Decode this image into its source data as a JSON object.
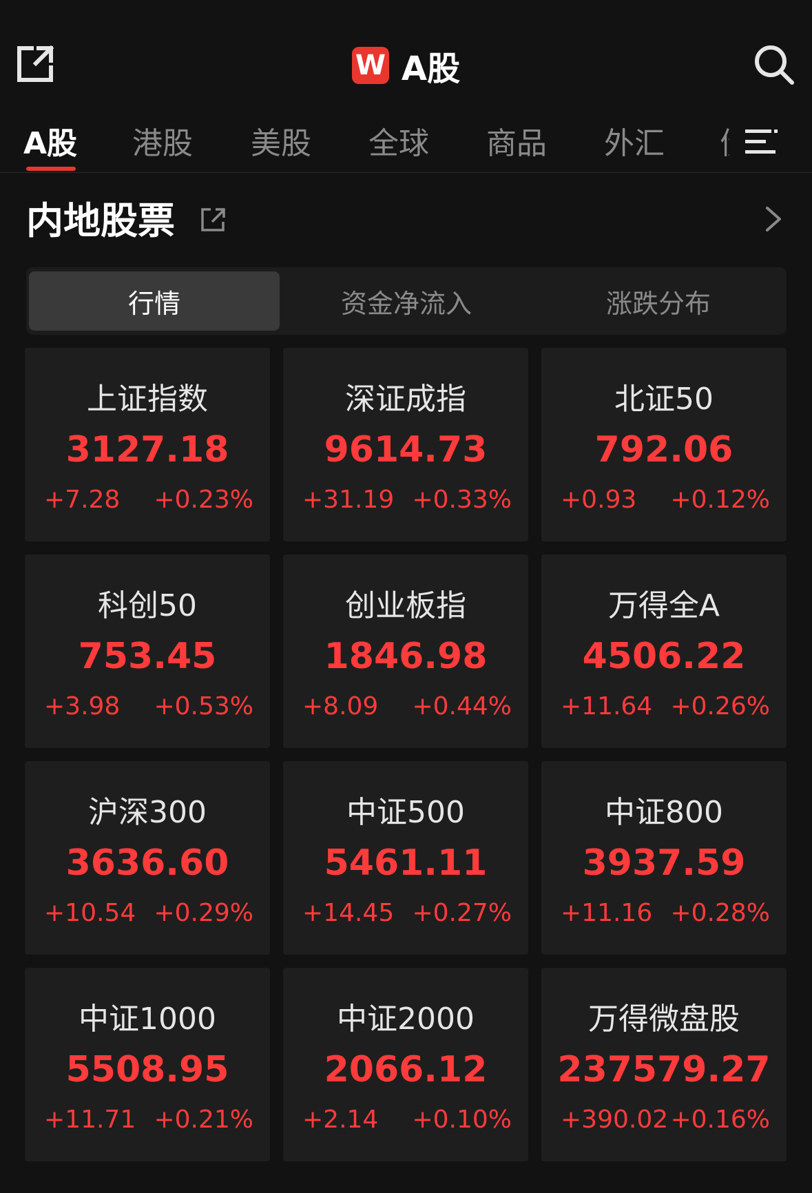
{
  "header": {
    "title": "A股",
    "logo_letter": "W",
    "icons": [
      "share-icon",
      "search-icon"
    ]
  },
  "tabs": [
    {
      "label": "A股",
      "active": true
    },
    {
      "label": "港股",
      "active": false
    },
    {
      "label": "美股",
      "active": false
    },
    {
      "label": "全球",
      "active": false
    },
    {
      "label": "商品",
      "active": false
    },
    {
      "label": "外汇",
      "active": false
    }
  ],
  "section": {
    "title": "内地股票"
  },
  "segments": [
    {
      "label": "行情",
      "active": true
    },
    {
      "label": "资金净流入",
      "active": false
    },
    {
      "label": "涨跌分布",
      "active": false
    }
  ],
  "indices": [
    {
      "name": "上证指数",
      "value": "3127.18",
      "change": "+7.28",
      "pct": "+0.23%"
    },
    {
      "name": "深证成指",
      "value": "9614.73",
      "change": "+31.19",
      "pct": "+0.33%"
    },
    {
      "name": "北证50",
      "value": "792.06",
      "change": "+0.93",
      "pct": "+0.12%"
    },
    {
      "name": "科创50",
      "value": "753.45",
      "change": "+3.98",
      "pct": "+0.53%"
    },
    {
      "name": "创业板指",
      "value": "1846.98",
      "change": "+8.09",
      "pct": "+0.44%"
    },
    {
      "name": "万得全A",
      "value": "4506.22",
      "change": "+11.64",
      "pct": "+0.26%"
    },
    {
      "name": "沪深300",
      "value": "3636.60",
      "change": "+10.54",
      "pct": "+0.29%"
    },
    {
      "name": "中证500",
      "value": "5461.11",
      "change": "+14.45",
      "pct": "+0.27%"
    },
    {
      "name": "中证800",
      "value": "3937.59",
      "change": "+11.16",
      "pct": "+0.28%"
    },
    {
      "name": "中证1000",
      "value": "5508.95",
      "change": "+11.71",
      "pct": "+0.21%"
    },
    {
      "name": "中证2000",
      "value": "2066.12",
      "change": "+2.14",
      "pct": "+0.10%"
    },
    {
      "name": "万得微盘股",
      "value": "237579.27",
      "change": "+390.02",
      "pct": "+0.16%"
    }
  ],
  "colors": {
    "background": "#121212",
    "card": "#1e1e1e",
    "up": "#ff3b3b",
    "accent": "#e8372f"
  }
}
